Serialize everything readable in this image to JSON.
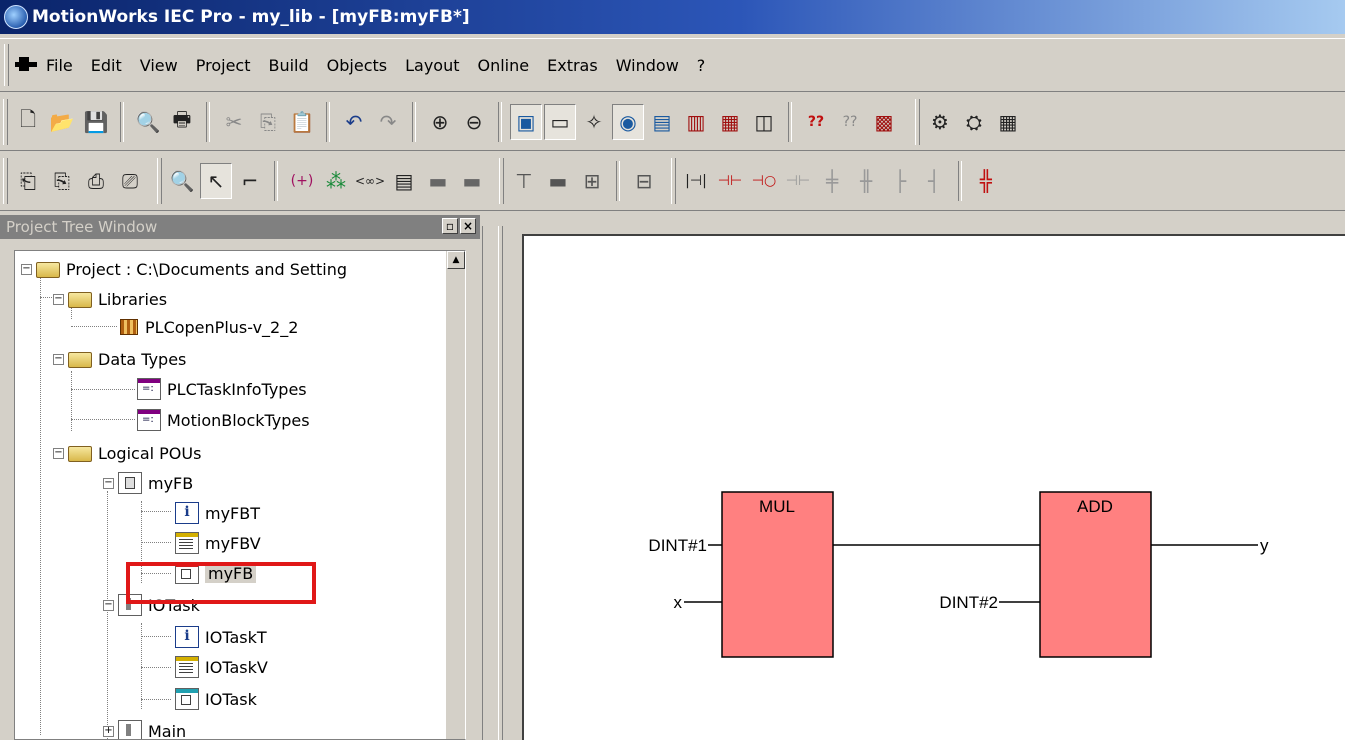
{
  "window": {
    "title": "MotionWorks IEC Pro - my_lib - [myFB:myFB*]",
    "app_icon": "motionworks-logo-icon"
  },
  "menu": {
    "items": [
      "File",
      "Edit",
      "View",
      "Project",
      "Build",
      "Objects",
      "Layout",
      "Online",
      "Extras",
      "Window",
      "?"
    ]
  },
  "toolbar1": {
    "buttons": [
      "new-icon",
      "open-icon",
      "save-icon",
      "print-preview-icon",
      "print-icon",
      "cut-icon",
      "copy-icon",
      "paste-icon",
      "undo-icon",
      "redo-icon",
      "zoom-in-icon",
      "zoom-out-icon",
      "project-tree-icon",
      "message-window-icon",
      "wizard-icon",
      "online-icon",
      "watch-icon",
      "logic-analyzer-icon",
      "cross-reference-icon",
      "library-icon",
      "help-icon",
      "context-help-icon",
      "edit-wizard-icon",
      "compile-icon",
      "make-icon",
      "resources-icon"
    ]
  },
  "toolbar2": {
    "buttons": [
      "insert-fb-icon",
      "insert-fb-2-icon",
      "insert-fb-3-icon",
      "insert-fb-4-icon",
      "find-icon",
      "pointer-icon",
      "connect-line-icon",
      "variable-icon",
      "negate-icon",
      "connector-icon",
      "insert-pou-icon",
      "add-input-icon",
      "add-output-icon",
      "jump-icon",
      "return-icon",
      "label-icon",
      "comment-icon",
      "contact-icon",
      "ld-no-contact-icon",
      "ld-coil-icon",
      "ld-nc-contact-icon",
      "ld-branch-icon",
      "ld-branch-2-icon",
      "ld-power-rail-icon",
      "ld-rail-icon",
      "ld-extra-icon"
    ]
  },
  "tree": {
    "header": "Project Tree Window",
    "nodes": {
      "project": "Project : C:\\Documents and Setting",
      "libraries": "Libraries",
      "plcopen": "PLCopenPlus-v_2_2",
      "datatypes": "Data Types",
      "plctask": "PLCTaskInfoTypes",
      "motionblock": "MotionBlockTypes",
      "logicalpous": "Logical POUs",
      "myfb": "myFB",
      "myfbt": "myFBT",
      "myfbv": "myFBV",
      "myfb_code": "myFB",
      "iotask": "IOTask",
      "iotaskt": "IOTaskT",
      "iotaskv": "IOTaskV",
      "iotask_code": "IOTask",
      "main": "Main"
    }
  },
  "editor": {
    "block1": {
      "name": "MUL",
      "in1": "DINT#1",
      "in2": "x"
    },
    "block2": {
      "name": "ADD",
      "in2": "DINT#2",
      "out": "y"
    },
    "block_fill": "#ff8080"
  },
  "colors": {
    "titlebar_start": "#0a246a",
    "highlight": "#e01818"
  }
}
